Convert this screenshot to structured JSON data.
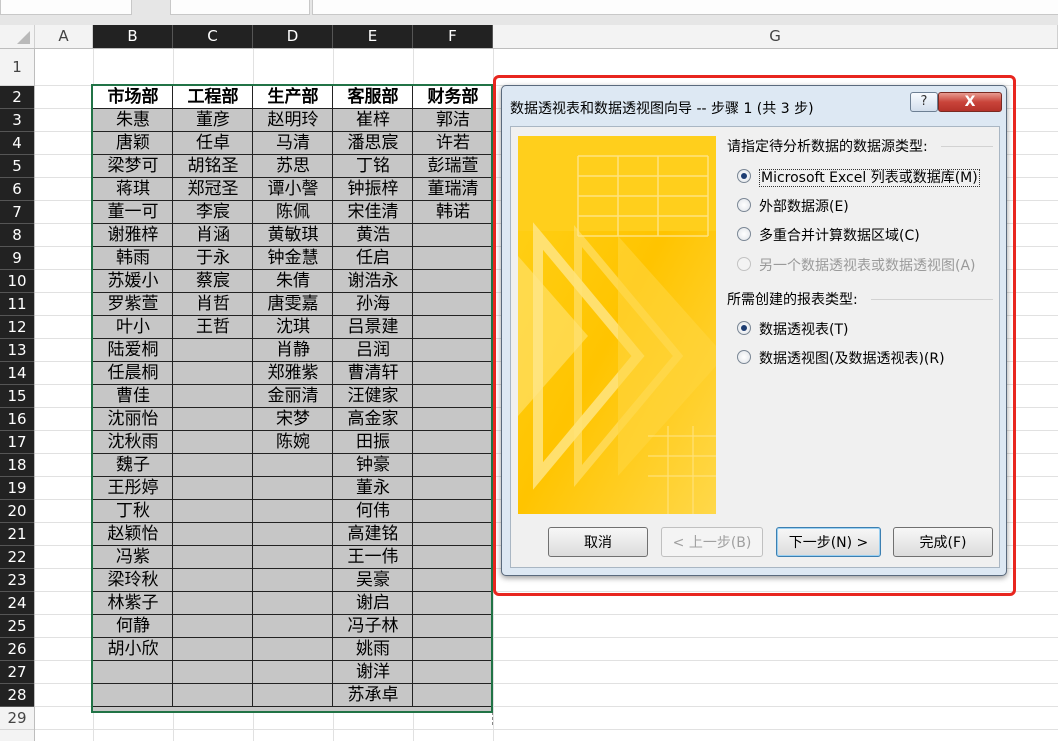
{
  "columns": [
    "A",
    "B",
    "C",
    "D",
    "E",
    "F",
    "G"
  ],
  "rows": [
    "1",
    "2",
    "3",
    "4",
    "5",
    "6",
    "7",
    "8",
    "9",
    "10",
    "11",
    "12",
    "13",
    "14",
    "15",
    "16",
    "17",
    "18",
    "19",
    "20",
    "21",
    "22",
    "23",
    "24",
    "25",
    "26",
    "27",
    "28",
    "29"
  ],
  "table": {
    "headers": [
      "市场部",
      "工程部",
      "生产部",
      "客服部",
      "财务部"
    ],
    "data": [
      [
        "朱惠",
        "董彦",
        "赵明玲",
        "崔梓",
        "郭洁"
      ],
      [
        "唐颖",
        "任卓",
        "马清",
        "潘思宸",
        "许若"
      ],
      [
        "梁梦可",
        "胡铭圣",
        "苏思",
        "丁铭",
        "彭瑞萱"
      ],
      [
        "蒋琪",
        "郑冠圣",
        "谭小謦",
        "钟振梓",
        "董瑞清"
      ],
      [
        "董一可",
        "李宸",
        "陈佩",
        "宋佳清",
        "韩诺"
      ],
      [
        "谢雅梓",
        "肖涵",
        "黄敏琪",
        "黄浩",
        ""
      ],
      [
        "韩雨",
        "于永",
        "钟金慧",
        "任启",
        ""
      ],
      [
        "苏媛小",
        "蔡宸",
        "朱倩",
        "谢浩永",
        ""
      ],
      [
        "罗紫萱",
        "肖哲",
        "唐雯嘉",
        "孙海",
        ""
      ],
      [
        "叶小",
        "王哲",
        "沈琪",
        "吕景建",
        ""
      ],
      [
        "陆爱桐",
        "",
        "肖静",
        "吕润",
        ""
      ],
      [
        "任晨桐",
        "",
        "郑雅紫",
        "曹清轩",
        ""
      ],
      [
        "曹佳",
        "",
        "金丽清",
        "汪健家",
        ""
      ],
      [
        "沈丽怡",
        "",
        "宋梦",
        "高金家",
        ""
      ],
      [
        "沈秋雨",
        "",
        "陈婉",
        "田振",
        ""
      ],
      [
        "魏子",
        "",
        "",
        "钟豪",
        ""
      ],
      [
        "王彤婷",
        "",
        "",
        "董永",
        ""
      ],
      [
        "丁秋",
        "",
        "",
        "何伟",
        ""
      ],
      [
        "赵颖怡",
        "",
        "",
        "高建铭",
        ""
      ],
      [
        "冯紫",
        "",
        "",
        "王一伟",
        ""
      ],
      [
        "梁玲秋",
        "",
        "",
        "吴豪",
        ""
      ],
      [
        "林紫子",
        "",
        "",
        "谢启",
        ""
      ],
      [
        "何静",
        "",
        "",
        "冯子林",
        ""
      ],
      [
        "胡小欣",
        "",
        "",
        "姚雨",
        ""
      ],
      [
        "",
        "",
        "",
        "谢洋",
        ""
      ],
      [
        "",
        "",
        "",
        "苏承卓",
        ""
      ]
    ]
  },
  "dialog": {
    "title": "数据透视表和数据透视图向导 -- 步骤 1 (共 3 步)",
    "help": "?",
    "close": "X",
    "section1": "请指定待分析数据的数据源类型:",
    "source_options": [
      {
        "label": "Microsoft Excel 列表或数据库(M)",
        "checked": true,
        "disabled": false
      },
      {
        "label": "外部数据源(E)",
        "checked": false,
        "disabled": false
      },
      {
        "label": "多重合并计算数据区域(C)",
        "checked": false,
        "disabled": false
      },
      {
        "label": "另一个数据透视表或数据透视图(A)",
        "checked": false,
        "disabled": true
      }
    ],
    "section2": "所需创建的报表类型:",
    "report_options": [
      {
        "label": "数据透视表(T)",
        "checked": true
      },
      {
        "label": "数据透视图(及数据透视表)(R)",
        "checked": false
      }
    ],
    "buttons": {
      "cancel": "取消",
      "back": "< 上一步(B)",
      "next": "下一步(N) >",
      "finish": "完成(F)"
    }
  },
  "colors": {
    "selection_border": "#217346",
    "highlight": "#e8261f",
    "banner": "#ffc800"
  }
}
